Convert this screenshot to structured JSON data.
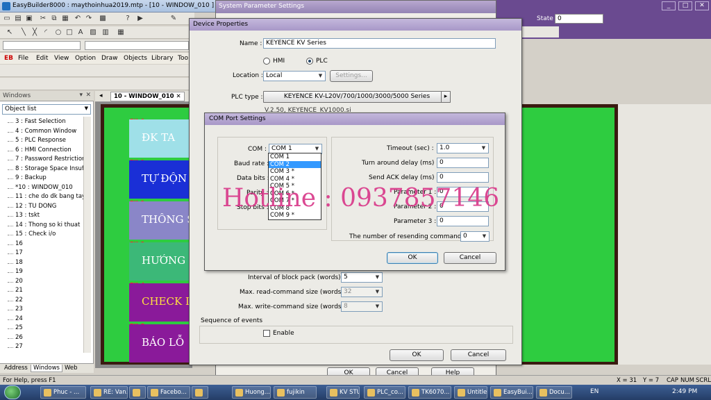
{
  "app": {
    "title": "EasyBuilder8000 : maythoinhua2019.mtp - [10 - WINDOW_010 ]",
    "state_label": "State",
    "state_value": "0",
    "menu": [
      "File",
      "Edit",
      "View",
      "Option",
      "Draw",
      "Objects",
      "Library",
      "Too"
    ],
    "font_selector": ""
  },
  "left_panel": {
    "header": "Windows",
    "selector": "Object list",
    "items": [
      "3 : Fast Selection",
      "4 : Common Window",
      "5 : PLC Response",
      "6 : HMI Connection",
      "7 : Password Restriction",
      "8 : Storage Space Insuff",
      "9 : Backup",
      "*10 : WINDOW_010",
      "11 : che do dk bang tay",
      "12 : TU DONG",
      "13 : tskt",
      "14 : Thong so ki thuat",
      "15 : Check i/o",
      "16",
      "17",
      "18",
      "19",
      "20",
      "21",
      "22",
      "23",
      "24",
      "25",
      "26",
      "27"
    ],
    "tabs": [
      "Address",
      "Windows",
      "Web"
    ]
  },
  "window_tab": "10 - WINDOW_010",
  "canvas_buttons": [
    {
      "fk": "FK_0",
      "label": "ĐK TA",
      "color": "#9fe0e8",
      "text_color": "#ffffff"
    },
    {
      "fk": "FK_1",
      "label": "TỰ ĐỘN",
      "color": "#1a2fd6",
      "text_color": "#ffffff"
    },
    {
      "fk": "FK_2",
      "label": "THÔNG S",
      "color": "#8a86c8",
      "text_color": "#ffffff"
    },
    {
      "fk": "FK_3",
      "label": "HƯỚNG D",
      "color": "#3cb878",
      "text_color": "#ffffff"
    },
    {
      "fk": "FK_4",
      "label": "CHECK I",
      "color": "#8a1a9a",
      "text_color": "#ffe040"
    },
    {
      "fk": "FK_5",
      "label": "BÁO LỖ",
      "color": "#8a1a9a",
      "text_color": "#ffffff"
    }
  ],
  "system_parameter": {
    "title": "System Parameter Settings",
    "ok": "OK",
    "cancel": "Cancel",
    "help": "Help"
  },
  "device_properties": {
    "title": "Device Properties",
    "name_label": "Name :",
    "name_value": "KEYENCE KV Series",
    "hmi": "HMI",
    "plc": "PLC",
    "location_label": "Location :",
    "location_value": "Local",
    "settings_btn": "Settings...",
    "plc_type_label": "PLC type :",
    "plc_type_value": "KEYENCE KV-L20V/700/1000/3000/5000 Series",
    "version": "V.2.50, KEYENCE_KV1000.si",
    "interval_label": "Interval of block pack (words) :",
    "interval_value": "5",
    "max_read_label": "Max. read-command size (words) :",
    "max_read_value": "32",
    "max_write_label": "Max. write-command size (words) :",
    "max_write_value": "8",
    "sequence_label": "Sequence of events",
    "enable_label": "Enable",
    "ok": "OK",
    "cancel": "Cancel"
  },
  "com_port": {
    "title": "COM Port Settings",
    "com_label": "COM :",
    "com_value": "COM 1",
    "baud_label": "Baud rate :",
    "data_bits_label": "Data bits :",
    "parity_label": "Parity :",
    "stop_bits_label": "Stop bits :",
    "options": [
      "COM 1",
      "COM 2",
      "COM 3 *",
      "COM 4 *",
      "COM 5 *",
      "COM 6 *",
      "COM 7 *",
      "COM 8",
      "COM 9 *"
    ],
    "selected_index": 1,
    "timeout_label": "Timeout (sec) :",
    "timeout_value": "1.0",
    "turn_around_label": "Turn around delay (ms) :",
    "turn_around_value": "0",
    "send_ack_label": "Send ACK delay (ms) :",
    "send_ack_value": "0",
    "param1_label": "Parameter 1 :",
    "param1_value": "0",
    "param2_label": "Parameter 2 :",
    "param2_value": "0",
    "param3_label": "Parameter 3 :",
    "param3_value": "0",
    "resend_label": "The number of resending commands :",
    "resend_value": "0",
    "ok": "OK",
    "cancel": "Cancel"
  },
  "watermark": "Hotline : 0937857146",
  "statusbar": {
    "help": "For Help, press F1",
    "x": "X = 31",
    "y": "Y = 7",
    "caps": "CAP",
    "num": "NUM",
    "scrl": "SCRL"
  },
  "taskbar": {
    "tasks": [
      "Phuc - ...",
      "RE: Van...",
      "",
      "Facebo...",
      "",
      "Huong...",
      "fujikin",
      "KV STU...",
      "PLC_co...",
      "TK6070...",
      "Untitle...",
      "EasyBui...",
      "Docu..."
    ],
    "lang": "EN",
    "time": "2:49 PM"
  }
}
